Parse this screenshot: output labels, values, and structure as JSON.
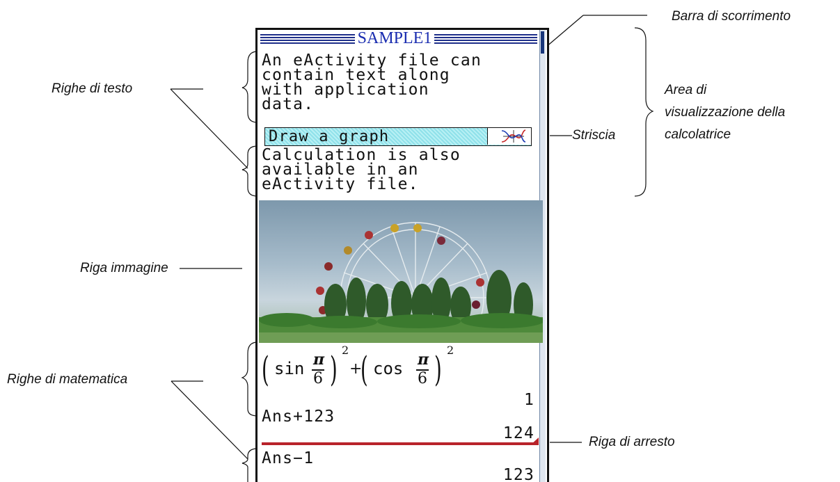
{
  "annotations": {
    "scrollbar": "Barra di scorrimento",
    "text_rows": "Righe di testo",
    "display_area_line1": "Area di",
    "display_area_line2": "visualizzazione della",
    "display_area_line3": "calcolatrice",
    "strip": "Striscia",
    "image_row": "Riga immagine",
    "math_rows": "Righe di matematica",
    "stop_line": "Riga di arresto"
  },
  "screen": {
    "title": "SAMPLE1",
    "text_block_1": [
      "An eActivity file can",
      "contain text along",
      "with application",
      "data."
    ],
    "strip_label": "Draw a graph",
    "strip_icon": "graph-icon",
    "text_block_2": [
      "Calculation is also",
      "available in an",
      "eActivity file."
    ],
    "image": "ferris-wheel-photo",
    "math": {
      "expr_func1": "sin",
      "expr_func2": "cos",
      "numerator": "π",
      "denominator": "6",
      "exponent": "2",
      "plus": "+",
      "result1": "1",
      "input2": "Ans+123",
      "result2": "124",
      "input3": "Ans−1",
      "result3": "123"
    }
  }
}
